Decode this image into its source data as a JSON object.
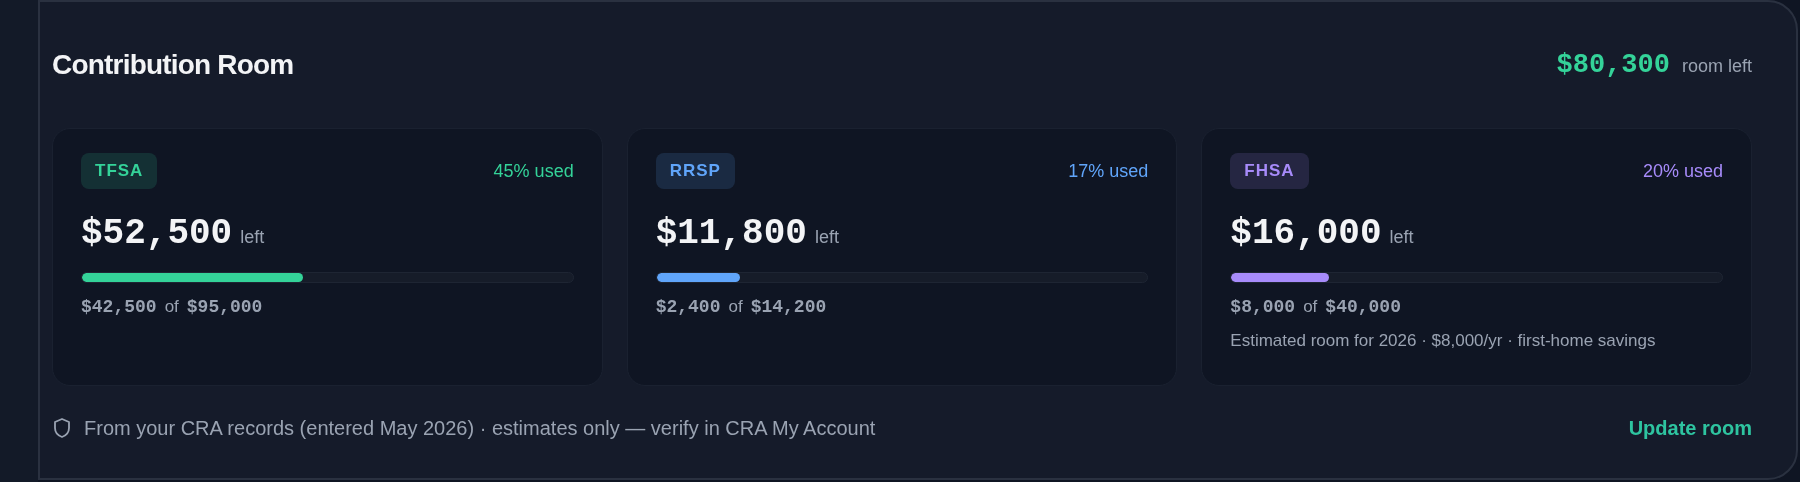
{
  "header": {
    "title": "Contribution Room",
    "total": "$80,300",
    "total_label": "room left"
  },
  "accounts": [
    {
      "name": "TFSA",
      "color": "#34d399",
      "used": "45% used",
      "left": "$52,500",
      "left_label": "left",
      "level": 0.45,
      "contributed": "$42,500",
      "of": "of",
      "limit": "$95,000"
    },
    {
      "name": "RRSP",
      "color": "#60a5fa",
      "used": "17% used",
      "left": "$11,800",
      "left_label": "left",
      "level": 0.17,
      "contributed": "$2,400",
      "of": "of",
      "limit": "$14,200"
    },
    {
      "name": "FHSA",
      "color": "#a78bfa",
      "used": "20% used",
      "left": "$16,000",
      "left_label": "left",
      "level": 0.2,
      "contributed": "$8,000",
      "of": "of",
      "limit": "$40,000",
      "note": "Estimated room for 2026 · $8,000/yr · first-home savings"
    }
  ],
  "footer": {
    "note": "From your CRA records (entered May 2026) · estimates only — verify in CRA My Account",
    "action": "Update room"
  }
}
